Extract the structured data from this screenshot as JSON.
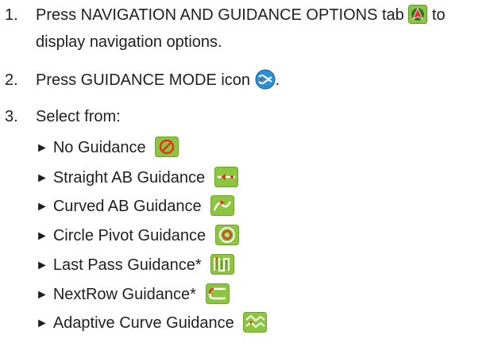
{
  "steps": [
    {
      "number": "1.",
      "text_before": "Press NAVIGATION AND GUIDANCE OPTIONS tab",
      "text_after": "to",
      "line2": "display navigation options.",
      "icon": "navigation-guidance-tab-icon"
    },
    {
      "number": "2.",
      "text_before": "Press GUIDANCE MODE icon",
      "text_after": ".",
      "icon": "guidance-mode-icon"
    },
    {
      "number": "3.",
      "text_before": "Select from:"
    }
  ],
  "options": [
    {
      "label": "No Guidance",
      "icon": "no-guidance-icon"
    },
    {
      "label": "Straight AB Guidance",
      "icon": "straight-ab-icon"
    },
    {
      "label": "Curved AB Guidance",
      "icon": "curved-ab-icon"
    },
    {
      "label": "Circle Pivot Guidance",
      "icon": "circle-pivot-icon"
    },
    {
      "label": "Last Pass Guidance*",
      "icon": "last-pass-icon"
    },
    {
      "label": "NextRow Guidance*",
      "icon": "nextrow-icon"
    },
    {
      "label": "Adaptive Curve Guidance",
      "icon": "adaptive-curve-icon"
    }
  ],
  "bullet_glyph": "►",
  "colors": {
    "icon_green": "#8cc63f",
    "icon_red": "#e53323",
    "icon_blue": "#2a8fd4"
  }
}
